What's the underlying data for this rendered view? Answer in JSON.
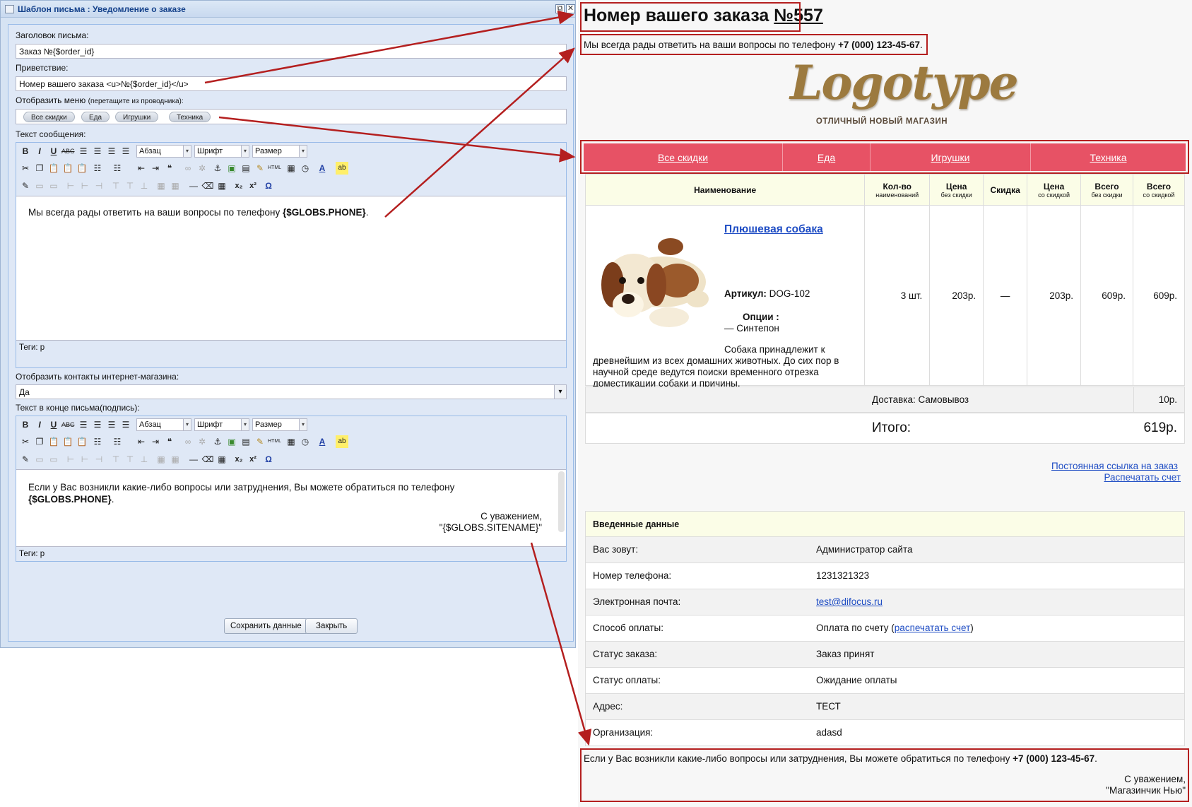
{
  "window": {
    "title": "Шаблон письма : Уведомление о заказе",
    "restore_glyph": "⧉",
    "close_glyph": "✕"
  },
  "form": {
    "subject_label": "Заголовок письма:",
    "subject_value": "Заказ №{$order_id}",
    "greeting_label": "Приветствие:",
    "greeting_value": "Номер вашего заказа <u>№{$order_id}</u>",
    "menu_label": "Отобразить меню",
    "menu_hint": "(перетащите из проводника):",
    "menu_chips": [
      "Все скидки",
      "Еда",
      "Игрушки",
      "Техника"
    ],
    "message_label": "Текст сообщения:",
    "toolbar": {
      "paragraph": "Абзац",
      "font": "Шрифт",
      "size": "Размер"
    },
    "message_text": "Мы всегда рады ответить на ваши вопросы по телефону ",
    "message_var": "{$GLOBS.PHONE}",
    "message_end": ".",
    "tags_label": "Теги: p",
    "contacts_label": "Отобразить контакты интернет-магазина:",
    "contacts_value": "Да",
    "signature_label": "Текст в конце письма(подпись):",
    "signature_text": "Если у Вас возникли какие-либо вопросы или затруднения, Вы можете обратиться по телефону",
    "signature_var": "{$GLOBS.PHONE}",
    "signature_end": ".",
    "signature_regards": "С уважением,",
    "signature_site": "\"{$GLOBS.SITENAME}\"",
    "tags_label2": "Теги: p",
    "save_button": "Сохранить данные",
    "close_button": "Закрыть"
  },
  "preview": {
    "title_prefix": "Номер вашего заказа ",
    "title_number": "№557",
    "phone_text": "Мы всегда рады ответить на ваши вопросы по телефону ",
    "phone_number": "+7 (000) 123-45-67",
    "phone_end": ".",
    "logo_word": "Logotype",
    "logo_tagline": "ОТЛИЧНЫЙ НОВЫЙ МАГАЗИН",
    "menu": [
      "Все скидки",
      "Еда",
      "Игрушки",
      "Техника"
    ],
    "table_headers": {
      "name": "Наименование",
      "qty": "Кол-во",
      "qty_sub": "наименований",
      "price": "Цена",
      "price_sub": "без скидки",
      "discount": "Скидка",
      "price_disc": "Цена",
      "price_disc_sub": "со скидкой",
      "total": "Всего",
      "total_sub": "без скидки",
      "total_disc": "Всего",
      "total_disc_sub": "со скидкой"
    },
    "product": {
      "name": "Плюшевая собака",
      "article_label": "Артикул:",
      "article": "DOG-102",
      "options_label": "Опции :",
      "option": "— Синтепон",
      "description": "Собака принадлежит к древнейшим из всех домашних животных. До сих пор в научной среде ведутся поиски временного отрезка доместикации собаки и причины.",
      "qty": "3 шт.",
      "price": "203р.",
      "discount": "—",
      "price_disc": "203р.",
      "total": "609р.",
      "total_disc": "609р."
    },
    "delivery_label": "Доставка: Самовывоз",
    "delivery_price": "10р.",
    "total_label": "Итого:",
    "total_value": "619р.",
    "permalink": "Постоянная ссылка на заказ",
    "print_invoice": "Распечатать счет",
    "user_data_header": "Введенные данные",
    "user_data": [
      {
        "k": "Вас зовут:",
        "v": "Администратор сайта"
      },
      {
        "k": "Номер телефона:",
        "v": "1231321323"
      },
      {
        "k": "Электронная почта:",
        "v": "test@difocus.ru"
      },
      {
        "k": "Способ оплаты:",
        "v": "Оплата по счету (",
        "link": "распечатать счет",
        "after": ")"
      },
      {
        "k": "Статус заказа:",
        "v": "Заказ принят"
      },
      {
        "k": "Статус оплаты:",
        "v": "Ожидание оплаты"
      },
      {
        "k": "Адрес:",
        "v": "ТЕСТ"
      },
      {
        "k": "Организация:",
        "v": "adasd"
      }
    ],
    "footer_text": "Если у Вас возникли какие-либо вопросы или затруднения, Вы можете обратиться по телефону ",
    "footer_phone": "+7 (000) 123-45-67",
    "footer_end": ".",
    "footer_regards": "С уважением,",
    "footer_site": "\"Магазинчик Нью\""
  }
}
